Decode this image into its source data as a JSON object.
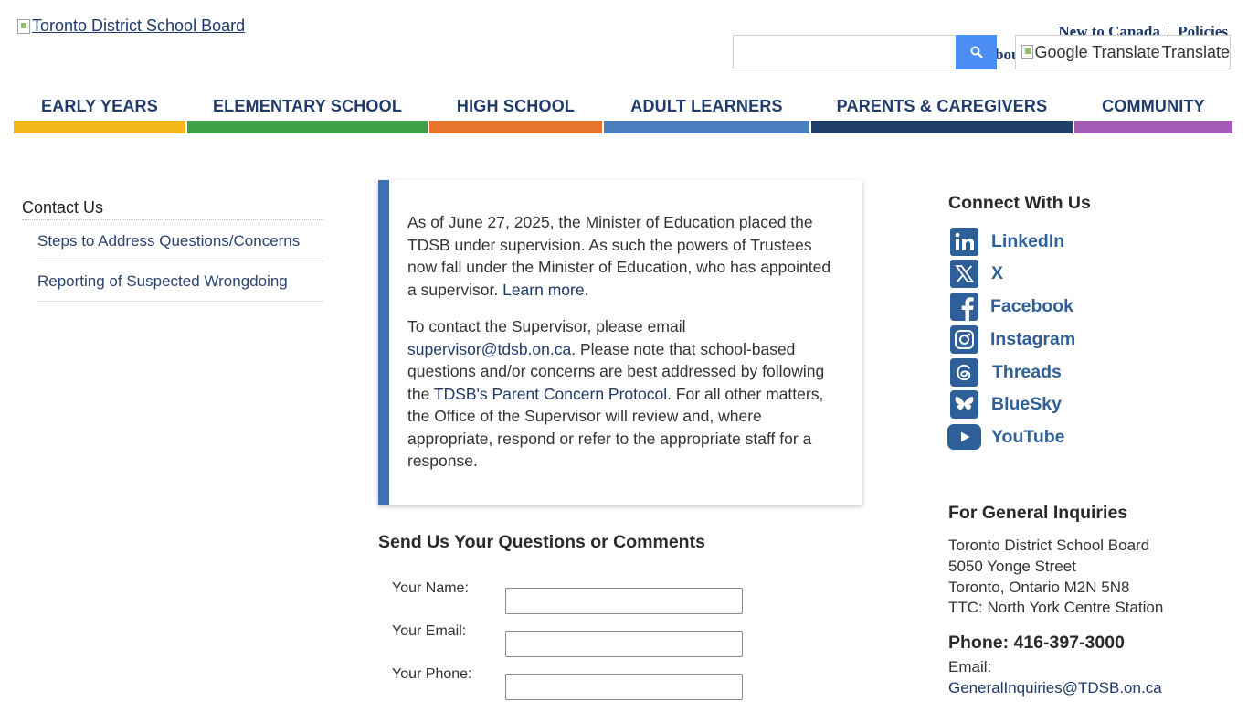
{
  "header": {
    "logo_alt": "Toronto District School Board",
    "top_links": [
      "New to Canada",
      "|",
      "Policies"
    ],
    "hidden_text": "bou",
    "search": {
      "placeholder": "",
      "value": ""
    },
    "translate": {
      "img_alt": "Google Translate",
      "label": "Translate"
    }
  },
  "nav": [
    {
      "label": "EARLY YEARS",
      "color": "#f5b81c"
    },
    {
      "label": "ELEMENTARY SCHOOL",
      "color": "#3ea047"
    },
    {
      "label": "HIGH SCHOOL",
      "color": "#e8732a"
    },
    {
      "label": "ADULT LEARNERS",
      "color": "#4a7fbf"
    },
    {
      "label": "PARENTS & CAREGIVERS",
      "color": "#203f6b"
    },
    {
      "label": "COMMUNITY",
      "color": "#a35bb8"
    }
  ],
  "sidebar": {
    "title": "Contact Us",
    "items": [
      "Steps to Address Questions/Concerns",
      "Reporting of Suspected Wrongdoing"
    ]
  },
  "notice": {
    "p1": "As of June 27, 2025, the Minister of Education placed the TDSB under supervision. As such the powers of Trustees now fall under the Minister of Education, who has appointed a supervisor.",
    "p1_link": "Learn more.",
    "p2_a": "To contact the Supervisor, please email",
    "p2_email": "supervisor@tdsb.on.ca",
    "p2_b": ". Please note that school-based questions and/or concerns are best addressed by following the",
    "p2_link": "TDSB's Parent Concern Protocol",
    "p2_c": ". For all other matters, the Office of the Supervisor will review and, where appropriate, respond or refer to the appropriate staff for a response."
  },
  "form": {
    "title": "Send Us Your Questions or Comments",
    "fields": [
      {
        "label": "Your Name:",
        "value": ""
      },
      {
        "label": "Your Email:",
        "value": ""
      },
      {
        "label": "Your Phone:",
        "value": ""
      }
    ]
  },
  "connect": {
    "title": "Connect With Us",
    "accent_color": "#2f5f99",
    "items": [
      {
        "label": "LinkedIn",
        "icon": "linkedin-icon"
      },
      {
        "label": "X",
        "icon": "x-icon"
      },
      {
        "label": "Facebook",
        "icon": "facebook-icon"
      },
      {
        "label": "Instagram",
        "icon": "instagram-icon"
      },
      {
        "label": "Threads",
        "icon": "threads-icon"
      },
      {
        "label": "BlueSky",
        "icon": "bluesky-icon"
      },
      {
        "label": "YouTube",
        "icon": "youtube-icon"
      }
    ]
  },
  "general": {
    "title": "For General Inquiries",
    "address": [
      "Toronto District School Board",
      "5050 Yonge Street",
      "Toronto, Ontario M2N 5N8",
      "TTC: North York Centre Station"
    ],
    "phone": "Phone: 416-397-3000",
    "email_label": "Email:",
    "email": "GeneralInquiries@TDSB.on.ca"
  }
}
